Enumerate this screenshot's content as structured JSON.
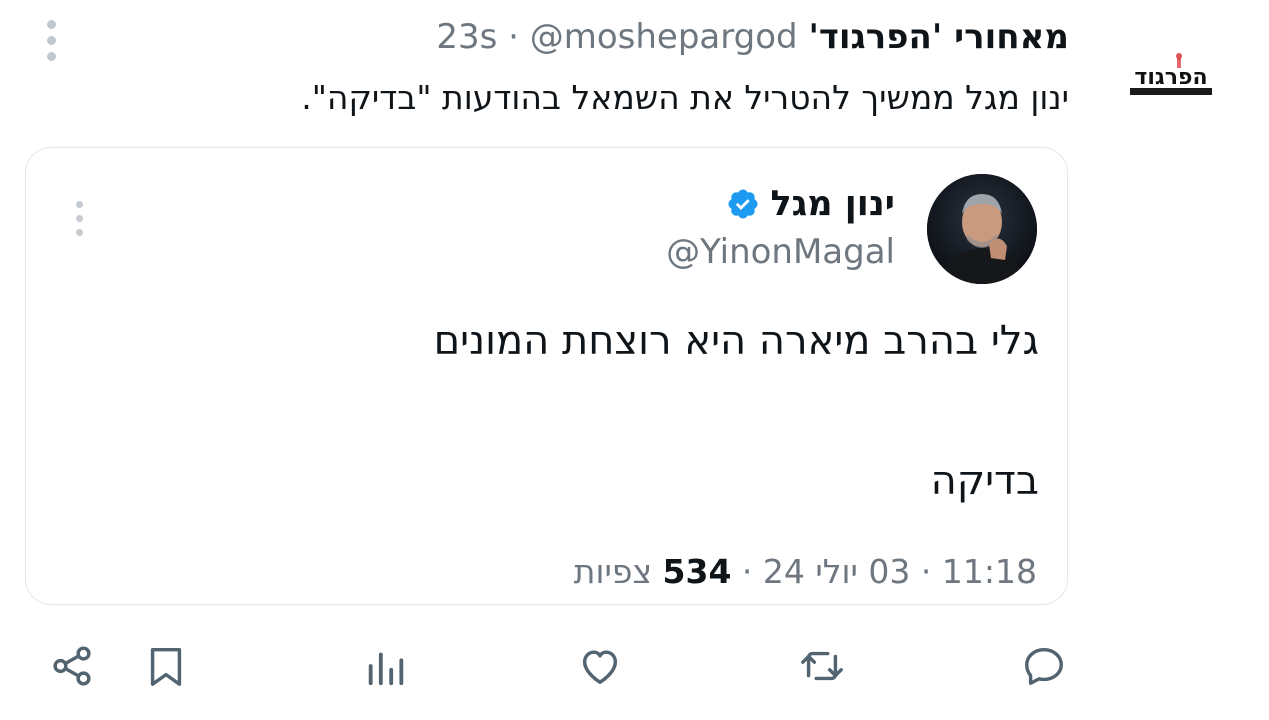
{
  "tweet": {
    "name": "מאחורי 'הפרגוד'",
    "meta": "23s · @moshepargod",
    "text": "ינון מגל ממשיך להטריל את השמאל  בהודעות \"בדיקה\".",
    "logo_text": "הפרגוד"
  },
  "quote": {
    "name": "ינון מגל",
    "handle": "@YinonMagal",
    "line1": "גלי בהרב מיארה היא רוצחת המונים",
    "line2": "בדיקה",
    "time_date": "11:18 · 03 יולי 24 · ",
    "views": "534",
    "views_label": " צפיות"
  },
  "actions": [
    {
      "icon": "share-icon"
    },
    {
      "icon": "bookmark-icon"
    },
    {
      "icon": "analytics-icon"
    },
    {
      "icon": "like-icon"
    },
    {
      "icon": "retweet-icon"
    },
    {
      "icon": "reply-icon"
    }
  ],
  "colors": {
    "text": "#0f1419",
    "secondary": "#6e7780",
    "border": "#e3e7ea",
    "verified": "#1d9bf0",
    "logo_red": "#d7262c"
  }
}
